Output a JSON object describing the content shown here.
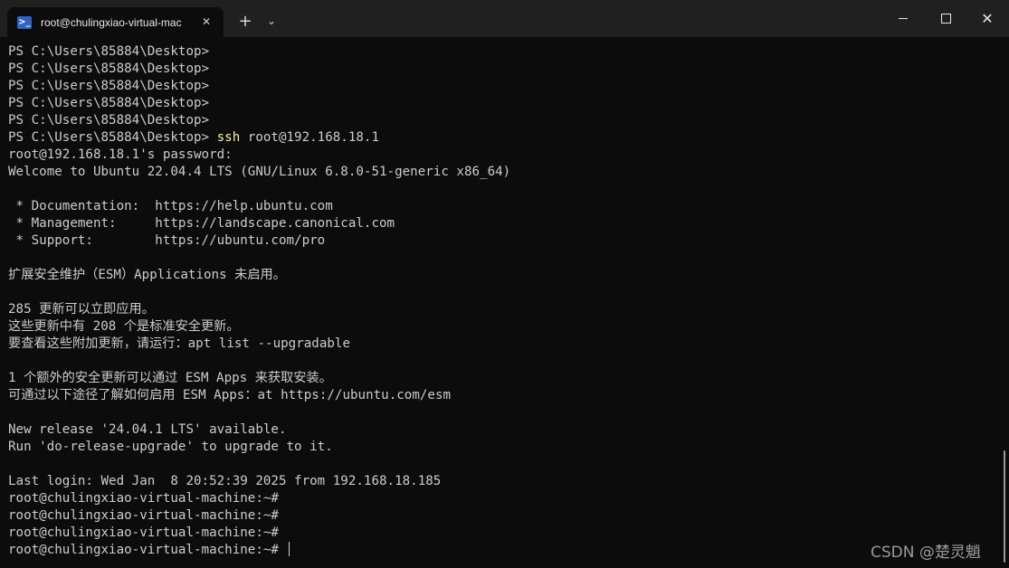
{
  "window": {
    "tab_title": "root@chulingxiao-virtual-mac",
    "tab_icon": "powershell-icon",
    "new_tab_label": "+",
    "dropdown_label": "⌄",
    "close_tab_label": "✕",
    "minimize_label": "",
    "maximize_label": "",
    "close_label": "✕"
  },
  "terminal": {
    "lines": [
      {
        "text": "PS C:\\Users\\85884\\Desktop>"
      },
      {
        "text": "PS C:\\Users\\85884\\Desktop>"
      },
      {
        "text": "PS C:\\Users\\85884\\Desktop>"
      },
      {
        "text": "PS C:\\Users\\85884\\Desktop>"
      },
      {
        "text": "PS C:\\Users\\85884\\Desktop>"
      },
      {
        "text": "PS C:\\Users\\85884\\Desktop> ",
        "cmd": "ssh",
        "rest": " root@192.168.18.1"
      },
      {
        "text": "root@192.168.18.1's password:"
      },
      {
        "text": "Welcome to Ubuntu 22.04.4 LTS (GNU/Linux 6.8.0-51-generic x86_64)"
      },
      {
        "text": ""
      },
      {
        "text": " * Documentation:  https://help.ubuntu.com"
      },
      {
        "text": " * Management:     https://landscape.canonical.com"
      },
      {
        "text": " * Support:        https://ubuntu.com/pro"
      },
      {
        "text": ""
      },
      {
        "text": "扩展安全维护（ESM）Applications 未启用。"
      },
      {
        "text": ""
      },
      {
        "text": "285 更新可以立即应用。"
      },
      {
        "text": "这些更新中有 208 个是标准安全更新。"
      },
      {
        "text": "要查看这些附加更新，请运行：apt list --upgradable"
      },
      {
        "text": ""
      },
      {
        "text": "1 个额外的安全更新可以通过 ESM Apps 来获取安装。"
      },
      {
        "text": "可通过以下途径了解如何启用 ESM Apps：at https://ubuntu.com/esm"
      },
      {
        "text": ""
      },
      {
        "text": "New release '24.04.1 LTS' available."
      },
      {
        "text": "Run 'do-release-upgrade' to upgrade to it."
      },
      {
        "text": ""
      },
      {
        "text": "Last login: Wed Jan  8 20:52:39 2025 from 192.168.18.185"
      },
      {
        "text": "root@chulingxiao-virtual-machine:~#"
      },
      {
        "text": "root@chulingxiao-virtual-machine:~#"
      },
      {
        "text": "root@chulingxiao-virtual-machine:~#"
      },
      {
        "text": "root@chulingxiao-virtual-machine:~# ",
        "cursor": true
      }
    ]
  },
  "watermark": "CSDN @楚灵魈",
  "colors": {
    "background": "#0c0c0c",
    "titlebar": "#202020",
    "text": "#cccccc",
    "command_highlight": "#f9f1a5"
  }
}
